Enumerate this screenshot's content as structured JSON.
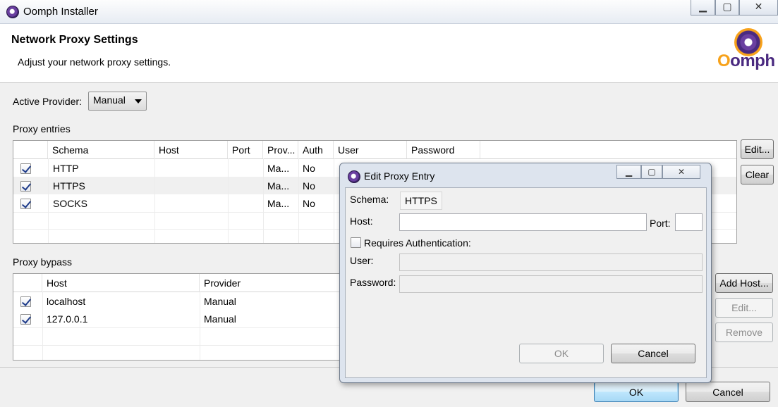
{
  "window": {
    "title": "Oomph Installer",
    "controls": {
      "minimize": "▁",
      "maximize": "▢",
      "close": "✕"
    }
  },
  "header": {
    "title": "Network Proxy Settings",
    "subtitle": "Adjust your network proxy settings.",
    "logo_text_o": "O",
    "logo_text_rest": "omph"
  },
  "provider": {
    "label": "Active Provider:",
    "value": "Manual"
  },
  "proxy_entries": {
    "label": "Proxy entries",
    "columns": [
      "Schema",
      "Host",
      "Port",
      "Prov...",
      "Auth",
      "User",
      "Password"
    ],
    "rows": [
      {
        "checked": true,
        "schema": "HTTP",
        "host": "",
        "port": "",
        "provider": "Ma...",
        "auth": "No"
      },
      {
        "checked": true,
        "schema": "HTTPS",
        "host": "",
        "port": "",
        "provider": "Ma...",
        "auth": "No"
      },
      {
        "checked": true,
        "schema": "SOCKS",
        "host": "",
        "port": "",
        "provider": "Ma...",
        "auth": "No"
      }
    ],
    "buttons": {
      "edit": "Edit...",
      "clear": "Clear"
    }
  },
  "proxy_bypass": {
    "label": "Proxy bypass",
    "columns": [
      "Host",
      "Provider"
    ],
    "rows": [
      {
        "checked": true,
        "host": "localhost",
        "provider": "Manual"
      },
      {
        "checked": true,
        "host": "127.0.0.1",
        "provider": "Manual"
      }
    ],
    "buttons": {
      "add_host": "Add Host...",
      "edit": "Edit...",
      "remove": "Remove"
    }
  },
  "footer": {
    "ok": "OK",
    "cancel": "Cancel"
  },
  "dialog": {
    "title": "Edit Proxy Entry",
    "schema_label": "Schema:",
    "schema_value": "HTTPS",
    "host_label": "Host:",
    "host_value": "",
    "port_label": "Port:",
    "port_value": "",
    "requires_auth_label": "Requires Authentication:",
    "requires_auth_checked": false,
    "user_label": "User:",
    "user_value": "",
    "password_label": "Password:",
    "password_value": "",
    "ok": "OK",
    "cancel": "Cancel"
  }
}
